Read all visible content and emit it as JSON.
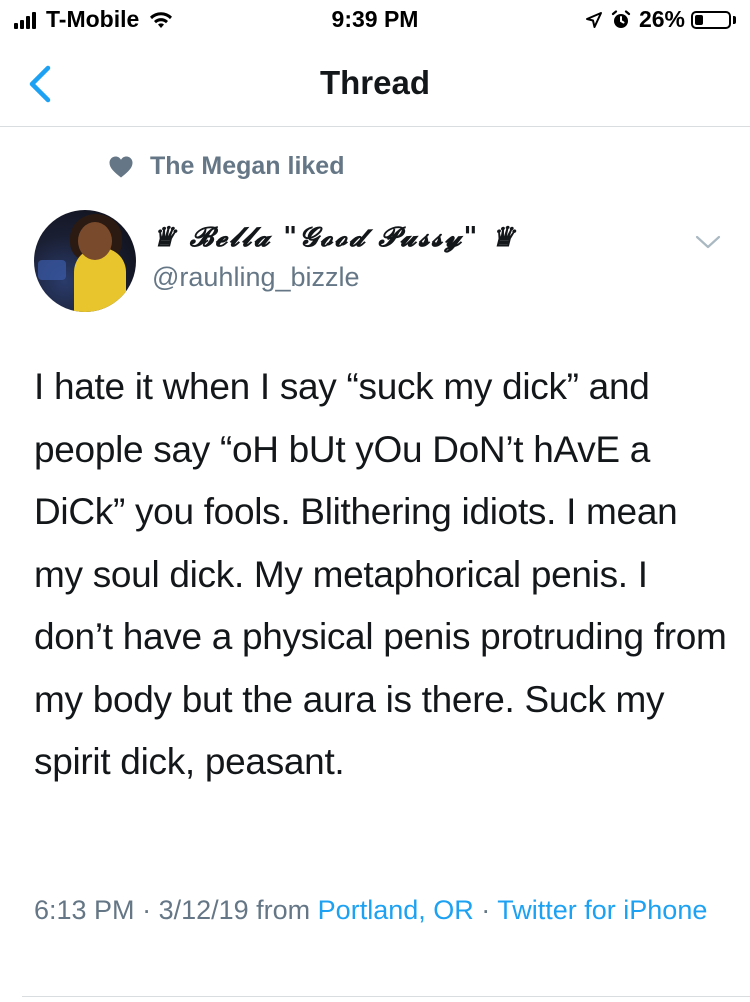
{
  "status_bar": {
    "carrier": "T-Mobile",
    "time": "9:39 PM",
    "battery_percent": "26%",
    "battery_level": 0.26,
    "icons": [
      "signal-icon",
      "wifi-icon",
      "location-arrow-icon",
      "alarm-icon",
      "battery-icon"
    ]
  },
  "nav": {
    "title": "Thread",
    "back_icon": "chevron-left-icon"
  },
  "social_context": {
    "icon": "heart-icon",
    "text": "The Megan liked"
  },
  "author": {
    "display_name": "♛ 𝓑𝓮𝓵𝓵𝓪 \"𝓖𝓸𝓸𝓭 𝓟𝓾𝓼𝓼𝔂\" ♛",
    "handle": "@rauhling_bizzle",
    "menu_icon": "chevron-down-icon"
  },
  "tweet": {
    "text": "I hate it when I say “suck my dick” and people say “oH bUt yOu DoN’t hAvE a DiCk” you fools. Blithering idiots. I mean my soul dick. My metaphorical penis. I don’t have a physical penis protruding from my body but the aura is there. Suck my spirit dick, peasant."
  },
  "meta": {
    "time": "6:13 PM",
    "sep1": " · ",
    "date": "3/12/19",
    "from_text": " from ",
    "location": "Portland, OR",
    "sep2": " · ",
    "source": "Twitter for iPhone"
  },
  "colors": {
    "accent": "#1da1f2",
    "secondary_text": "#657786",
    "primary_text": "#14171a",
    "divider": "#d9dde0",
    "heart": "#657786"
  }
}
